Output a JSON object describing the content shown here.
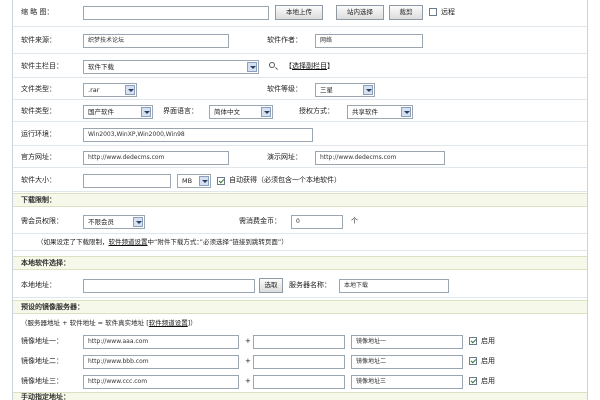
{
  "thumb": {
    "label": "缩 略 图：",
    "upload": "本地上传",
    "choose": "站内选择",
    "crop": "裁剪",
    "remote": "远程"
  },
  "source": {
    "label": "软件来源：",
    "value": "织梦技术论坛",
    "author_label": "软件作者：",
    "author_value": "网络"
  },
  "column": {
    "label": "软件主栏目：",
    "value": "软件下载",
    "sub_link": "选择副栏目"
  },
  "filetype": {
    "label": "文件类型：",
    "value": ".rar",
    "level_label": "软件等级：",
    "level_value": "三星"
  },
  "softtype": {
    "label": "软件类型：",
    "value": "国产软件",
    "lang_label": "界面语言：",
    "lang_value": "简体中文",
    "license_label": "授权方式：",
    "license_value": "共享软件"
  },
  "env": {
    "label": "运行环境：",
    "value": "Win2003,WinXP,Win2000,Win98"
  },
  "site": {
    "label": "官方网址：",
    "value": "http://www.dedecms.com",
    "demo_label": "演示网址：",
    "demo_value": "http://www.dedecms.com"
  },
  "size": {
    "label": "软件大小：",
    "unit": "MB",
    "auto": "自动获得（必须包含一个本地软件）"
  },
  "limit": {
    "section": "下载限制：",
    "rank_label": "需会员权限：",
    "rank_value": "不限会员",
    "coin_label": "需消费金币：",
    "coin_value": "0",
    "coin_unit": "个",
    "note_pre": "（如果设定了下载限制，",
    "note_link": "软件频道设置",
    "note_post": "中“附件下载方式：”必须选择“链接到跳转页面”）"
  },
  "local": {
    "section": "本地软件选择：",
    "label": "本地地址：",
    "browse": "选取",
    "server_label": "服务器名称：",
    "server_value": "本地下载"
  },
  "mirror": {
    "section": "预设的镜像服务器：",
    "formula_pre": "（服务器地址 + 软件地址 = 软件真实地址 [",
    "formula_link": "软件频道设置",
    "formula_post": "]）",
    "plus": "+",
    "enable": "启用",
    "rows": [
      {
        "label": "镜像地址一：",
        "url": "http://www.aaa.com",
        "name": "镜像地址一"
      },
      {
        "label": "镜像地址二：",
        "url": "http://www.bbb.com",
        "name": "镜像地址二"
      },
      {
        "label": "镜像地址三：",
        "url": "http://www.ccc.com",
        "name": "镜像地址三"
      }
    ]
  },
  "manual": {
    "section": "手动指定地址："
  }
}
